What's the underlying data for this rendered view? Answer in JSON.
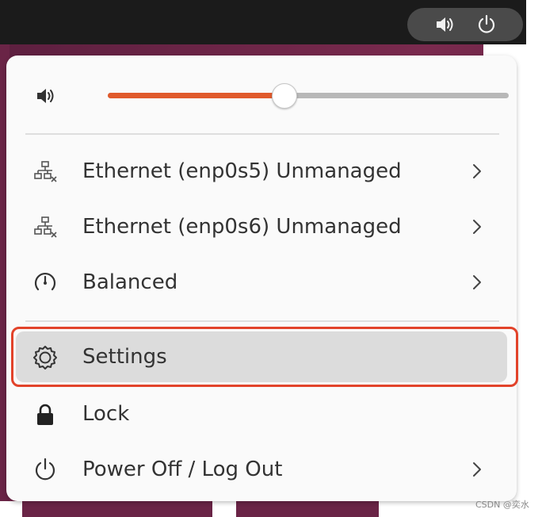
{
  "colors": {
    "accent": "#e05a2c",
    "highlight_border": "#e2432a",
    "menu_bg": "#fafafa",
    "topbar_bg": "#1b1b1b",
    "tray_bg": "#4a4a4a"
  },
  "tray": {
    "icons": [
      "speaker-icon",
      "power-icon"
    ]
  },
  "volume": {
    "icon": "speaker-icon",
    "level_percent": 44
  },
  "items": [
    {
      "label": "Ethernet (enp0s5) Unmanaged",
      "icon": "network-wired-icon",
      "has_submenu": true
    },
    {
      "label": "Ethernet (enp0s6) Unmanaged",
      "icon": "network-wired-icon",
      "has_submenu": true
    },
    {
      "label": "Balanced",
      "icon": "power-profile-icon",
      "has_submenu": true
    },
    {
      "label": "Settings",
      "icon": "gear-icon",
      "has_submenu": false,
      "highlighted": true
    },
    {
      "label": "Lock",
      "icon": "lock-icon",
      "has_submenu": false
    },
    {
      "label": "Power Off / Log Out",
      "icon": "power-icon",
      "has_submenu": true
    }
  ],
  "watermark": "CSDN @奕水"
}
